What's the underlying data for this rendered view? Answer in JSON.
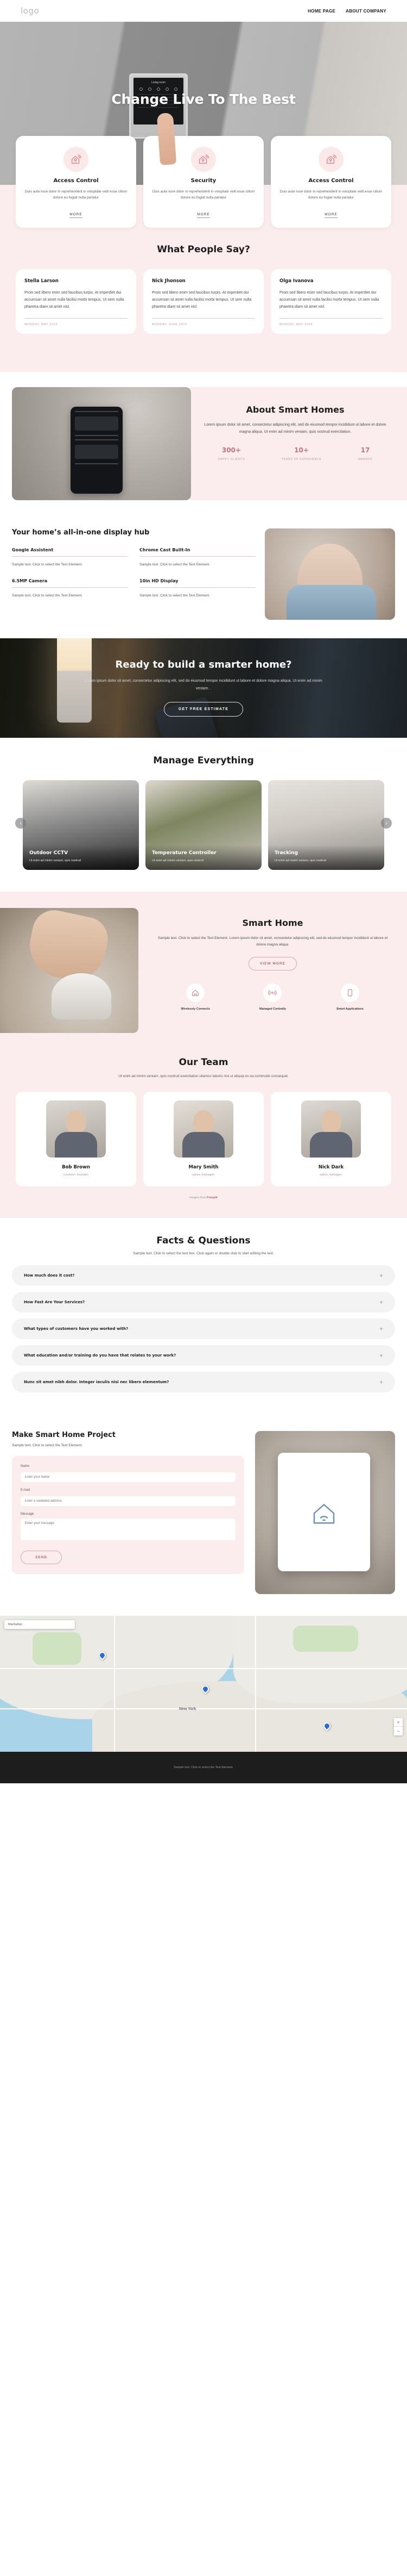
{
  "header": {
    "logo": "logo",
    "nav": [
      {
        "label": "HOME PAGE"
      },
      {
        "label": "ABOUT COMPANY"
      }
    ]
  },
  "hero": {
    "title": "Change Live To The Best",
    "panel_title": "Living room"
  },
  "features": [
    {
      "title": "Access Control",
      "text": "Duis aute irure dolor in reprehenderit in voluptate velit esse cillum dolore eu fugiat nulla pariatur",
      "more": "MORE"
    },
    {
      "title": "Security",
      "text": "Duis aute irure dolor in reprehenderit in voluptate velit esse cillum dolore eu fugiat nulla pariatur",
      "more": "MORE"
    },
    {
      "title": "Access Control",
      "text": "Duis aute irure dolor in reprehenderit in voluptate velit esse cillum dolore eu fugiat nulla pariatur",
      "more": "MORE"
    }
  ],
  "testimonials": {
    "title": "What People Say?",
    "items": [
      {
        "name": "Stella Larson",
        "text": "Proin sed libero enim sed faucibus turpis. At imperdiet dui accumsan sit amet nulla facilisi morbi tempus. Ut sem nulla pharetra diam sit amet nisl.",
        "date": "MONDAY, MAY 2024"
      },
      {
        "name": "Nick Jhonson",
        "text": "Proin sed libero enim sed faucibus turpis. At imperdiet dui accumsan sit amet nulla facilisi morbi tempus. Ut sem nulla pharetra diam sit amet nisl.",
        "date": "MONDAY, JUNE 2024"
      },
      {
        "name": "Olga Ivanova",
        "text": "Proin sed libero enim sed faucibus turpis. At imperdiet dui accumsan sit amet nulla facilisi morbi tempus. Ut sem nulla pharetra diam sit amet nisl.",
        "date": "MONDAY, MAY 2024"
      }
    ]
  },
  "about": {
    "title": "About Smart Homes",
    "text": "Lorem ipsum dolor sit amet, consectetur adipiscing elit, sed do eiusmod tempor incididunt ut labore et dolore magna aliqua. Ut enim ad minim veniam, quis nostrud exercitation.",
    "stats": [
      {
        "num": "300+",
        "label": "HAPPY CLIENTS"
      },
      {
        "num": "10+",
        "label": "YEARS OF EXPERIENCE"
      },
      {
        "num": "17",
        "label": "AWARDS"
      }
    ]
  },
  "hub": {
    "title": "Your home’s all-in-one display hub",
    "items": [
      {
        "title": "Google Assistent",
        "text": "Sample text. Click to select the Text Element."
      },
      {
        "title": "Chrome Cast Built-In",
        "text": "Sample text. Click to select the Text Element."
      },
      {
        "title": "6.5MP Camera",
        "text": "Sample text. Click to select the Text Element."
      },
      {
        "title": "10in HD Display",
        "text": "Sample text. Click to select the Text Element."
      }
    ]
  },
  "cta": {
    "title": "Ready to build a smarter home?",
    "text": "Lorem ipsum dolor sit amet, consectetur adipiscing elit, sed do eiusmod tempor incididunt ut labore et dolore magna aliqua. Ut enim ad minim veniam. .",
    "button": "GET FREE ESTIMATE"
  },
  "manage": {
    "title": "Manage Everything",
    "cards": [
      {
        "title": "Outdoor CCTV",
        "text": "Ut enim ad minim veniam, quis nostrud"
      },
      {
        "title": "Temperature Controller",
        "text": "Ut enim ad minim veniam, quis nostrud"
      },
      {
        "title": "Tracking",
        "text": "Ut enim ad minim veniam, quis nostrud"
      }
    ],
    "prev": "‹",
    "next": "›"
  },
  "smart": {
    "title": "Smart Home",
    "text": "Sample text. Click to select the Text Element. Lorem ipsum dolor sit amet, consectetur adipiscing elit, sed do eiusmod tempor incididunt ut labore et dolore magna aliqua.",
    "button": "VIEW MORE",
    "features": [
      {
        "caption": "Wirelessly Connects",
        "icon": "home-wifi-icon"
      },
      {
        "caption": "Managed Centrally",
        "icon": "signal-icon"
      },
      {
        "caption": "Smart Applications",
        "icon": "phone-app-icon"
      }
    ]
  },
  "team": {
    "title": "Our Team",
    "subtitle": "Ut enim ad minim veniam, quis nostrud exercitation ullamco laboris nisi ut aliquip ex ea commodo consequat.",
    "members": [
      {
        "name": "Bob Brown",
        "role": "coutiner founder"
      },
      {
        "name": "Mary Smith",
        "role": "sales manager"
      },
      {
        "name": "Nick Dark",
        "role": "sales manager"
      }
    ],
    "credit_prefix": "Images from ",
    "credit_link": "Freepik"
  },
  "faq": {
    "title": "Facts & Questions",
    "subtitle": "Sample text. Click to select the text box. Click again or double click to start editing the text.",
    "items": [
      {
        "question": "How much does it cost?",
        "toggle": "+"
      },
      {
        "question": "How Fast Are Your Services?",
        "toggle": "+"
      },
      {
        "question": "What types of customers have you worked with?",
        "toggle": "+"
      },
      {
        "question": "What education and/or training do you have that relates to your work?",
        "toggle": "+"
      },
      {
        "question": "Nunc sit amet nibh dolor. Integer iaculis nisi nec libero elementum?",
        "toggle": "+"
      }
    ]
  },
  "project": {
    "title": "Make Smart Home Project",
    "subtitle": "Sample text. Click to select the Text Element.",
    "form": {
      "name_label": "Name",
      "name_placeholder": "Enter your Name",
      "email_label": "E-mail",
      "email_placeholder": "Enter a validated address",
      "message_label": "Message",
      "message_placeholder": "Enter your message",
      "submit": "SEND"
    }
  },
  "map": {
    "search_placeholder": "Manhattan",
    "city_label": "New York",
    "zoom_in": "+",
    "zoom_out": "−"
  },
  "footer": {
    "text": "Sample text. Click to select the Text Element."
  }
}
